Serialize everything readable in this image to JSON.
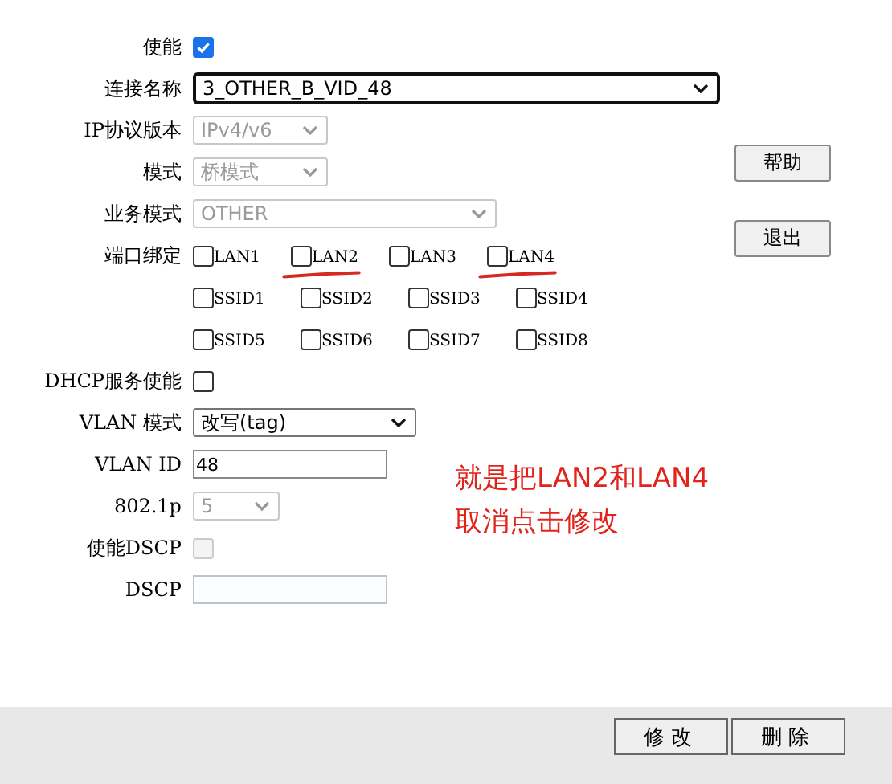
{
  "fields": [
    {
      "label": "使能",
      "kind": "checkbox",
      "checked": true,
      "disabled": false
    },
    {
      "label": "连接名称",
      "kind": "select",
      "value": "3_OTHER_B_VID_48",
      "disabled": false
    },
    {
      "label": "IP协议版本",
      "kind": "select",
      "value": "IPv4/v6",
      "disabled": true
    },
    {
      "label": "模式",
      "kind": "select",
      "value": "桥模式",
      "disabled": true
    },
    {
      "label": "业务模式",
      "kind": "select",
      "value": "OTHER",
      "disabled": true
    },
    {
      "label": "端口绑定",
      "kind": "ports",
      "rows": [
        [
          {
            "label": "LAN1",
            "checked": false,
            "marked": false
          },
          {
            "label": "LAN2",
            "checked": false,
            "marked": true
          },
          {
            "label": "LAN3",
            "checked": false,
            "marked": false
          },
          {
            "label": "LAN4",
            "checked": false,
            "marked": true
          }
        ],
        [
          {
            "label": "SSID1",
            "checked": false,
            "marked": false
          },
          {
            "label": "SSID2",
            "checked": false,
            "marked": false
          },
          {
            "label": "SSID3",
            "checked": false,
            "marked": false
          },
          {
            "label": "SSID4",
            "checked": false,
            "marked": false
          }
        ],
        [
          {
            "label": "SSID5",
            "checked": false,
            "marked": false
          },
          {
            "label": "SSID6",
            "checked": false,
            "marked": false
          },
          {
            "label": "SSID7",
            "checked": false,
            "marked": false
          },
          {
            "label": "SSID8",
            "checked": false,
            "marked": false
          }
        ]
      ]
    },
    {
      "label": "DHCP服务使能",
      "kind": "checkbox",
      "checked": false,
      "disabled": false
    },
    {
      "label": "VLAN 模式",
      "kind": "select",
      "value": "改写(tag)",
      "disabled": false
    },
    {
      "label": "VLAN ID",
      "kind": "text",
      "value": "48",
      "disabled": false
    },
    {
      "label": "802.1p",
      "kind": "select",
      "value": "5",
      "disabled": true
    },
    {
      "label": "使能DSCP",
      "kind": "checkbox",
      "checked": false,
      "disabled": true
    },
    {
      "label": "DSCP",
      "kind": "text",
      "disabled": true
    }
  ],
  "side_buttons": [
    "帮助",
    "退出"
  ],
  "annotation": {
    "lines": [
      "就是把LAN2和LAN4",
      "取消点击修改"
    ]
  },
  "footer_buttons": [
    "修改",
    "删除"
  ]
}
